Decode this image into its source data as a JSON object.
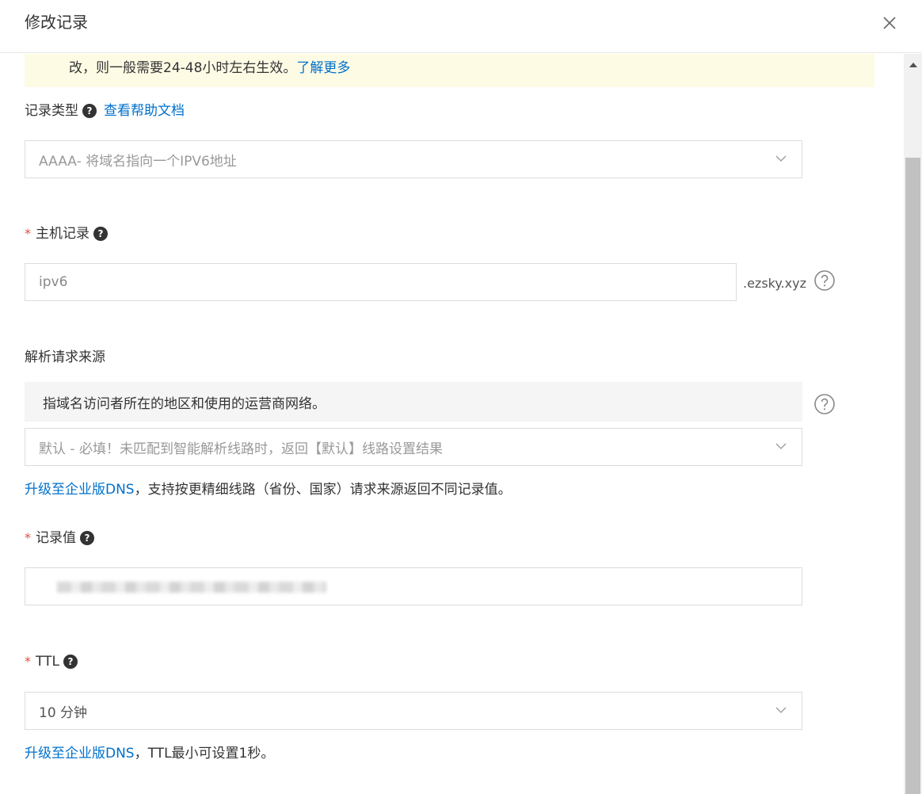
{
  "dialog": {
    "title": "修改记录"
  },
  "notice": {
    "text": "改，则一般需要24-48小时左右生效。",
    "link": "了解更多"
  },
  "record_type": {
    "label": "记录类型",
    "help_link": "查看帮助文档",
    "value": "AAAA- 将域名指向一个IPV6地址"
  },
  "host_record": {
    "label": "主机记录",
    "value": "ipv6",
    "suffix": ".ezsky.xyz"
  },
  "resolve_source": {
    "label": "解析请求来源",
    "hint": "指域名访问者所在的地区和使用的运营商网络。",
    "value": "默认 - 必填！未匹配到智能解析线路时，返回【默认】线路设置结果",
    "upgrade_link": "升级至企业版DNS",
    "upgrade_text": "，支持按更精细线路（省份、国家）请求来源返回不同记录值。"
  },
  "record_value": {
    "label": "记录值"
  },
  "ttl": {
    "label": "TTL",
    "value": "10 分钟",
    "upgrade_link": "升级至企业版DNS",
    "upgrade_text": "，TTL最小可设置1秒。"
  },
  "icons": {
    "help_mark": "?",
    "required_mark": "*"
  }
}
